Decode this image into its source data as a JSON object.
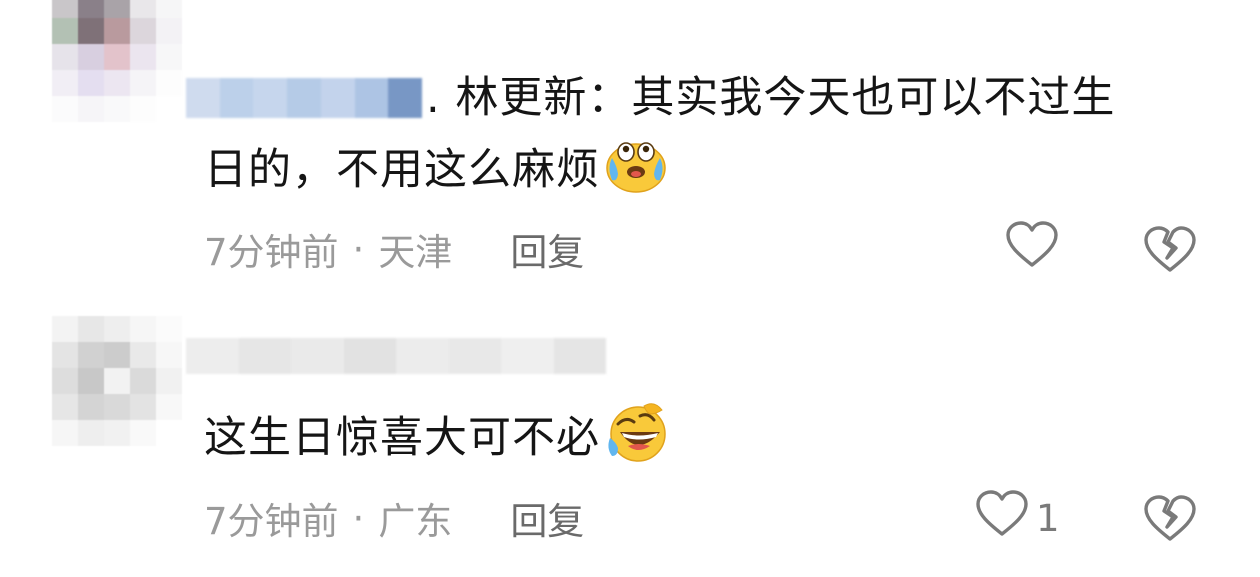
{
  "comments": [
    {
      "author_suffix": ". 林更新：",
      "text_line1": "其实我今天也可以不过生",
      "text_line2": "日的，不用这么麻烦",
      "emoji": "crying-face-icon",
      "time": "7分钟前",
      "separator": "·",
      "location": "天津",
      "reply_label": "回复",
      "likes": ""
    },
    {
      "text": "这生日惊喜大可不必",
      "emoji": "rolling-laughing-face-icon",
      "time": "7分钟前",
      "separator": "·",
      "location": "广东",
      "reply_label": "回复",
      "likes": "1"
    }
  ],
  "colors": {
    "text": "#151515",
    "meta": "#9a9a9a",
    "reply": "#6a6a6a",
    "icon": "#7a7a7a"
  }
}
